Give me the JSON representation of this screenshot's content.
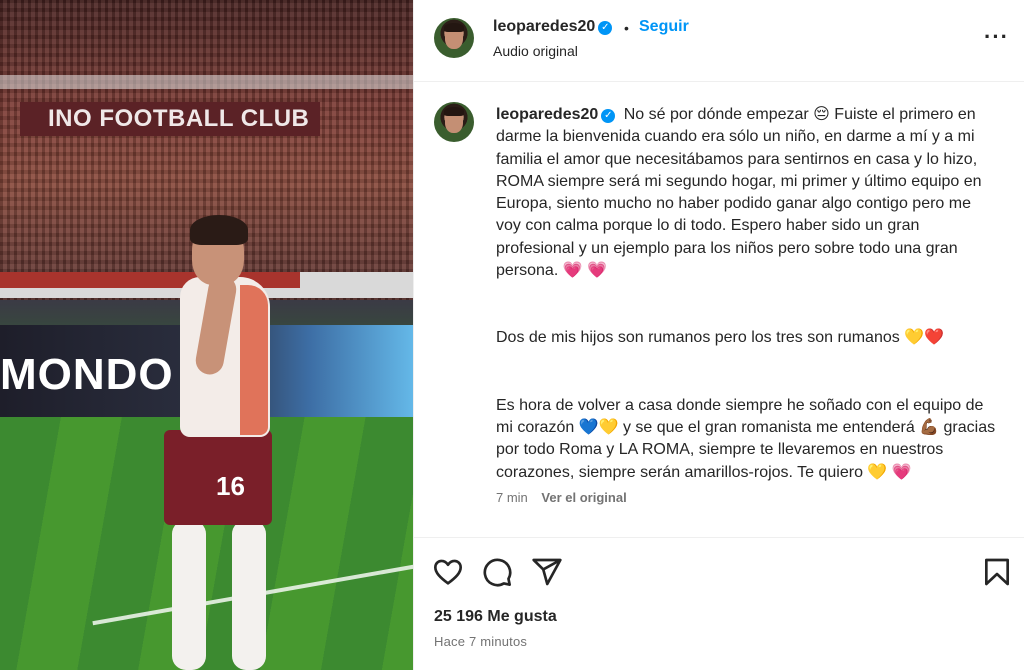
{
  "media": {
    "banner_text": "INO FOOTBALL CLUB",
    "board_text": "MONDO",
    "jersey_number": "16"
  },
  "header": {
    "username": "leoparedes20",
    "verified_icon": "✓",
    "separator": "•",
    "follow_label": "Seguir",
    "subtitle": "Audio original",
    "more_label": "···"
  },
  "caption": {
    "username": "leoparedes20",
    "paragraph_1": "No sé por dónde empezar 😔 Fuiste el primero en darme la bienvenida cuando era sólo un niño, en darme a mí y a mi familia el amor que necesitábamos para sentirnos en casa y lo hizo, ROMA siempre será mi segundo hogar, mi primer y último equipo en Europa, siento mucho no haber podido ganar algo contigo pero me voy con calma porque lo di todo. Espero haber sido un gran profesional y un ejemplo para los niños pero sobre todo una gran persona. 💗 💗",
    "paragraph_2": "Dos de mis hijos son rumanos pero los tres son rumanos 💛❤️",
    "paragraph_3": "Es hora de volver a casa donde siempre he soñado con el equipo de mi corazón 💙💛 y se que el gran romanista me entenderá 💪🏾 gracias por todo Roma y LA ROMA, siempre te llevaremos en nuestros corazones, siempre serán amarillos-rojos. Te quiero 💛 💗",
    "time_ago": "7 min",
    "see_original": "Ver el original"
  },
  "actions": {
    "likes": "25 196 Me gusta",
    "posted": "Hace 7 minutos"
  },
  "colors": {
    "accent": "#0095f6",
    "text": "#262626",
    "secondary": "#737373",
    "border": "#efefef"
  },
  "icons": [
    "heart-icon",
    "comment-icon",
    "share-icon",
    "bookmark-icon",
    "more-icon",
    "verified-icon"
  ]
}
